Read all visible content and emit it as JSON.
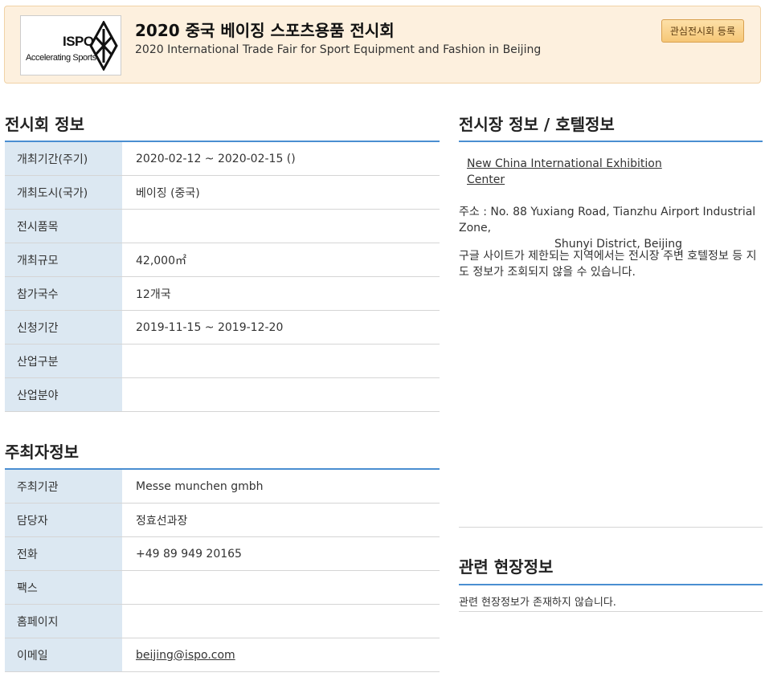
{
  "header": {
    "logo": {
      "brand": "ISPO",
      "tagline": "Accelerating Sports"
    },
    "title_ko": "2020 중국 베이징 스포츠용품 전시회",
    "title_en": "2020 International Trade Fair for Sport Equipment and Fashion in Beijing",
    "register_label": "관심전시회 등록"
  },
  "exhibition": {
    "title": "전시회 정보",
    "rows": [
      {
        "key": "개최기간(주기)",
        "value": "2020-02-12 ~ 2020-02-15 ()"
      },
      {
        "key": "개최도시(국가)",
        "value": "베이징 (중국)"
      },
      {
        "key": "전시품목",
        "value": ""
      },
      {
        "key": "개최규모",
        "value": "42,000㎡"
      },
      {
        "key": "참가국수",
        "value": "12개국"
      },
      {
        "key": "신청기간",
        "value": "2019-11-15 ~ 2019-12-20"
      },
      {
        "key": "산업구분",
        "value": ""
      },
      {
        "key": "산업분야",
        "value": ""
      }
    ]
  },
  "organizer": {
    "title": "주최자정보",
    "rows": [
      {
        "key": "주최기관",
        "value": "Messe munchen gmbh"
      },
      {
        "key": "담당자",
        "value": "정효선과장"
      },
      {
        "key": "전화",
        "value": "+49 89 949 20165"
      },
      {
        "key": "팩스",
        "value": ""
      },
      {
        "key": "홈페이지",
        "value": ""
      },
      {
        "key": "이메일",
        "value": "beijing@ispo.com"
      }
    ]
  },
  "venue": {
    "title": "전시장 정보 / 호텔정보",
    "name": "New China International Exhibition Center",
    "address_line1": "주소 : No. 88 Yuxiang Road, Tianzhu Airport Industrial Zone,",
    "address_line2": "Shunyi District, Beijing",
    "notice": "구글 사이트가 제한되는 지역에서는 전시장 주변 호텔정보 등 지도 정보가 조회되지 않을 수 있습니다."
  },
  "related": {
    "title": "관련 현장정보",
    "empty_text": "관련 현장정보가 존재하지 않습니다."
  }
}
